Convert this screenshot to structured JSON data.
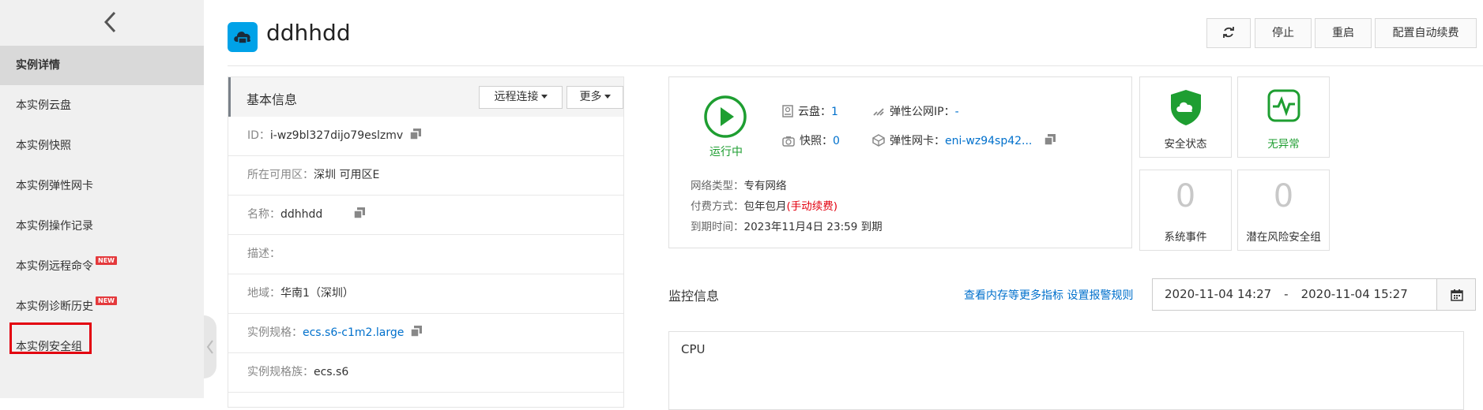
{
  "sidebar": {
    "items": [
      {
        "label": "实例详情"
      },
      {
        "label": "本实例云盘"
      },
      {
        "label": "本实例快照"
      },
      {
        "label": "本实例弹性网卡"
      },
      {
        "label": "本实例操作记录"
      },
      {
        "label": "本实例远程命令",
        "badge": "NEW"
      },
      {
        "label": "本实例诊断历史",
        "badge": "NEW"
      },
      {
        "label": "本实例安全组"
      }
    ]
  },
  "header": {
    "title": "ddhhdd",
    "buttons": {
      "stop": "停止",
      "restart": "重启",
      "auto_renew": "配置自动续费"
    }
  },
  "basic_info": {
    "title": "基本信息",
    "remote_connect": "远程连接",
    "more": "更多",
    "rows": [
      {
        "key": "ID：",
        "value": "i-wz9bl327dijo79eslzmv"
      },
      {
        "key": "所在可用区：",
        "value": "深圳 可用区E"
      },
      {
        "key": "名称：",
        "value": "ddhhdd"
      },
      {
        "key": "描述：",
        "value": ""
      },
      {
        "key": "地域：",
        "value": "华南1（深圳）"
      },
      {
        "key": "实例规格：",
        "value": "ecs.s6-c1m2.large"
      },
      {
        "key": "实例规格族：",
        "value": "ecs.s6"
      }
    ]
  },
  "status": {
    "run_label": "运行中",
    "disk_label": "云盘：",
    "disk_value": "1",
    "snapshot_label": "快照：",
    "snapshot_value": "0",
    "eip_label": "弹性公网IP：",
    "eip_value": "-",
    "eni_label": "弹性网卡：",
    "eni_value": "eni-wz94sp42...",
    "network_type_key": "网络类型：",
    "network_type_value": "专有网络",
    "payment_key": "付费方式：",
    "payment_value": "包年包月",
    "payment_note": "(手动续费)",
    "expire_key": "到期时间：",
    "expire_value": "2023年11月4日 23:59 到期"
  },
  "cards": {
    "security_status": "安全状态",
    "health": "无异常",
    "system_events_count": "0",
    "system_events": "系统事件",
    "risk_groups_count": "0",
    "risk_groups": "潜在风险安全组"
  },
  "monitor": {
    "title": "监控信息",
    "link_more": "查看内存等更多指标",
    "link_alarm": "设置报警规则",
    "date_start": "2020-11-04 14:27",
    "date_sep": "-",
    "date_end": "2020-11-04 15:27",
    "cpu_label": "CPU"
  },
  "colors": {
    "accent": "#00a2e8",
    "running": "#1e9e31",
    "link": "#0070cc",
    "highlight": "#e3000f"
  }
}
